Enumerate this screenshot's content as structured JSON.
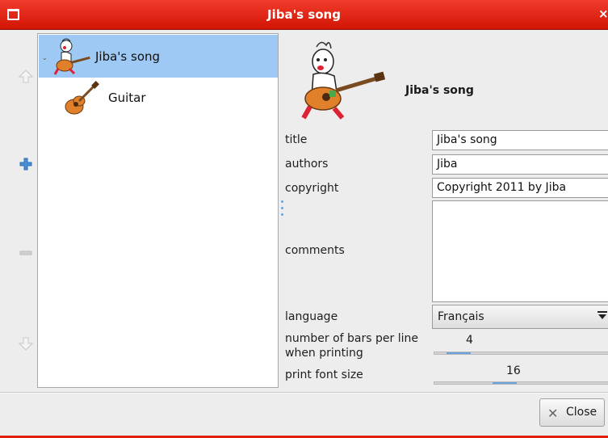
{
  "window": {
    "title": "Jiba's song",
    "menu_icon": "window-menu-icon",
    "close_glyph": "×"
  },
  "sidebar": {
    "move_up_icon": "arrow-up-icon",
    "add_icon": "plus-icon",
    "remove_icon": "minus-icon",
    "move_down_icon": "arrow-down-icon"
  },
  "tree": {
    "expander": "⌄",
    "items": [
      {
        "label": "Jiba's song",
        "icon": "jiba-guitarist-icon",
        "selected": true
      },
      {
        "label": "Guitar",
        "icon": "guitar-icon",
        "selected": false
      }
    ]
  },
  "properties": {
    "header": "Jiba's song",
    "header_icon": "jiba-guitarist-icon",
    "title_label": "title",
    "title_value": "Jiba's song",
    "authors_label": "authors",
    "authors_value": "Jiba",
    "copyright_label": "copyright",
    "copyright_value": "Copyright 2011 by Jiba",
    "comments_label": "comments",
    "comments_value": "",
    "language_label": "language",
    "language_value": "Français",
    "bars_label_line1": "number of bars per line",
    "bars_label_line2": "when printing",
    "bars_value": "4",
    "bars_fraction": 0.13,
    "font_label": "print font size",
    "font_value": "16",
    "font_fraction": 0.38
  },
  "footer": {
    "close_label": "Close",
    "close_icon": "close-icon"
  },
  "colors": {
    "titlebar": "#e0281a",
    "selection": "#9ec9f4",
    "accent": "#6aa2e0"
  }
}
